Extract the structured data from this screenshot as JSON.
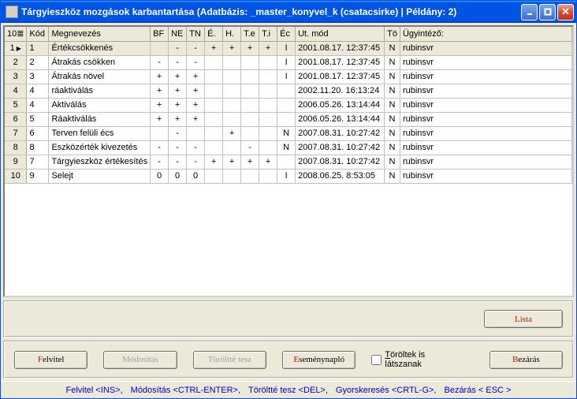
{
  "window": {
    "title": "Tárgyieszköz mozgások karbantartása   (Adatbázis:  _master_konyvel_k (csatacsirke)  |  Példány: 2)"
  },
  "columns": {
    "idx": "10≣",
    "kod": "Kód",
    "meg": "Megnevezés",
    "bf": "BF",
    "ne": "NE",
    "tn": "TN",
    "e": "É.",
    "h": "H.",
    "te": "T.e",
    "ti": "T.i",
    "ec": "Éc",
    "utm": "Ut. mód",
    "to": "Tö",
    "ugy": "Ügyintéző:"
  },
  "rows": [
    {
      "n": "1",
      "kod": "1",
      "meg": "Értékcsökkenés",
      "bf": "",
      "ne": "-",
      "tn": "-",
      "e": "+",
      "h": "+",
      "te": "+",
      "ti": "+",
      "ec": "I",
      "utm": "2001.08.17. 12:37:45",
      "to": "N",
      "ugy": "rubinsvr",
      "sel": true
    },
    {
      "n": "2",
      "kod": "2",
      "meg": "Átrakás csökken",
      "bf": "-",
      "ne": "-",
      "tn": "-",
      "e": "",
      "h": "",
      "te": "",
      "ti": "",
      "ec": "I",
      "utm": "2001.08.17. 12:37:45",
      "to": "N",
      "ugy": "rubinsvr"
    },
    {
      "n": "3",
      "kod": "3",
      "meg": "Átrakás növel",
      "bf": "+",
      "ne": "+",
      "tn": "+",
      "e": "",
      "h": "",
      "te": "",
      "ti": "",
      "ec": "I",
      "utm": "2001.08.17. 12:37:45",
      "to": "N",
      "ugy": "rubinsvr"
    },
    {
      "n": "4",
      "kod": "4",
      "meg": "ráaktiválás",
      "bf": "+",
      "ne": "+",
      "tn": "+",
      "e": "",
      "h": "",
      "te": "",
      "ti": "",
      "ec": "",
      "utm": "2002.11.20. 16:13:24",
      "to": "N",
      "ugy": "rubinsvr"
    },
    {
      "n": "5",
      "kod": "4",
      "meg": "Aktiválás",
      "bf": "+",
      "ne": "+",
      "tn": "+",
      "e": "",
      "h": "",
      "te": "",
      "ti": "",
      "ec": "",
      "utm": "2006.05.26. 13:14:44",
      "to": "N",
      "ugy": "rubinsvr"
    },
    {
      "n": "6",
      "kod": "5",
      "meg": "Ráaktiválás",
      "bf": "+",
      "ne": "+",
      "tn": "+",
      "e": "",
      "h": "",
      "te": "",
      "ti": "",
      "ec": "",
      "utm": "2006.05.26. 13:14:44",
      "to": "N",
      "ugy": "rubinsvr"
    },
    {
      "n": "7",
      "kod": "6",
      "meg": "Terven felüli écs",
      "bf": "",
      "ne": "-",
      "tn": "",
      "e": "",
      "h": "+",
      "te": "",
      "ti": "",
      "ec": "N",
      "utm": "2007.08.31. 10:27:42",
      "to": "N",
      "ugy": "rubinsvr"
    },
    {
      "n": "8",
      "kod": "8",
      "meg": "Eszközérték kivezetés",
      "bf": "-",
      "ne": "-",
      "tn": "-",
      "e": "",
      "h": "",
      "te": "-",
      "ti": "",
      "ec": "N",
      "utm": "2007.08.31. 10:27:42",
      "to": "N",
      "ugy": "rubinsvr"
    },
    {
      "n": "9",
      "kod": "7",
      "meg": "Tárgyieszköz értékesítés",
      "bf": "-",
      "ne": "-",
      "tn": "-",
      "e": "+",
      "h": "+",
      "te": "+",
      "ti": "+",
      "ec": "",
      "utm": "2007.08.31. 10:27:42",
      "to": "N",
      "ugy": "rubinsvr"
    },
    {
      "n": "10",
      "kod": "9",
      "meg": "Selejt",
      "bf": "0",
      "ne": "0",
      "tn": "0",
      "e": "",
      "h": "",
      "te": "",
      "ti": "",
      "ec": "I",
      "utm": "2008.06.25. 8:53:05",
      "to": "N",
      "ugy": "rubinsvr"
    }
  ],
  "buttons": {
    "lista": "Lista",
    "felvitel": "elvitel",
    "felvitel_a": "F",
    "modositas": "Módosítás",
    "torolte": "Töröltté tesz",
    "esemenynaplo": "seménynapló",
    "esemenynaplo_a": "E",
    "toroltek": "öröltek is látszanak",
    "toroltek_a": "T",
    "bezaras": "ezárás",
    "bezaras_a": "B"
  },
  "status": {
    "felvitel": "Felvitel <INS>,",
    "modositas": "Módosítás <CTRL-ENTER>,",
    "torolte": "Töröltté tesz <DEL>,",
    "gyors": "Gyorskeresés <CRTL-G>,",
    "bezaras": "Bezárás < ESC >"
  }
}
